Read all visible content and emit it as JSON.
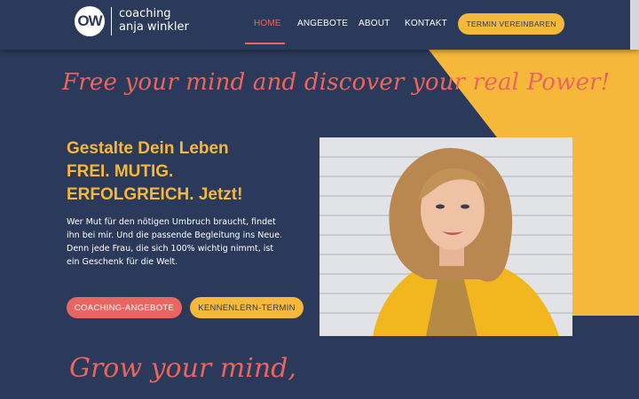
{
  "brand": {
    "mark": "OW",
    "line1": "coaching",
    "line2": "anja winkler"
  },
  "nav": [
    {
      "label": "HOME",
      "active": true
    },
    {
      "label": "ANGEBOTE",
      "active": false
    },
    {
      "label": "ABOUT",
      "active": false
    },
    {
      "label": "KONTAKT",
      "active": false
    }
  ],
  "header_cta": "TERMIN VEREINBAREN",
  "hero": {
    "script": "Free your mind and discover your real Power!",
    "headline": [
      "Gestalte Dein Leben",
      "FREI. MUTIG.",
      "ERFOLGREICH. Jetzt!"
    ],
    "intro": "Wer Mut für den nötigen Umbruch braucht, findet ihn bei mir. Und die passende Begleitung ins Neue. Denn jede Frau, die sich 100% wichtig nimmt, ist ein Geschenk für die Welt.",
    "button_primary": "COACHING-ANGEBOTE",
    "button_secondary": "KENNENLERN-TERMIN"
  },
  "section_script": "Grow your mind,",
  "colors": {
    "navy": "#2b3a5a",
    "coral": "#e8665f",
    "yellow": "#f6b83a",
    "white": "#ffffff"
  }
}
